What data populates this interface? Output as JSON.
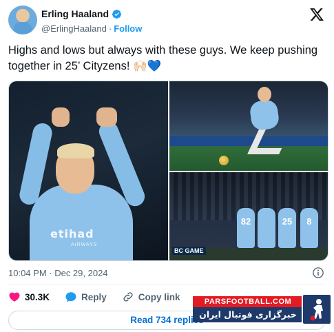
{
  "author": {
    "display_name": "Erling Haaland",
    "handle": "@ErlingHaaland",
    "follow_label": "Follow"
  },
  "tweet": {
    "text": "Highs and lows but always with these guys. We keep pushing together in 25’ Cityzens! 🙌🏻💙",
    "timestamp": "10:04 PM · Dec 29, 2024"
  },
  "media": {
    "photo1_sponsor": "etihad",
    "photo1_sponsor_sub": "AIRWAYS",
    "photo3_numbers": [
      "82",
      "25",
      "8"
    ],
    "photo3_board": "BC GAME"
  },
  "actions": {
    "like_count": "30.3K",
    "reply_label": "Reply",
    "copy_link_label": "Copy link"
  },
  "read_replies_label": "Read 734 replies",
  "watermark": {
    "top": "PARSFOOTBALL.COM",
    "bottom": "خبرگزاری فوتبال ایران"
  },
  "colors": {
    "accent_blue": "#1d9bf0",
    "like_pink": "#f91880",
    "city_blue": "#8ec2ea"
  }
}
